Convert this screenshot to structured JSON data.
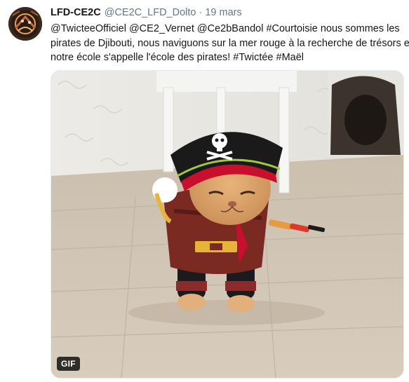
{
  "tweet": {
    "author_name": "LFD-CE2C",
    "author_handle": "@CE2C_LFD_Dolto",
    "separator": "·",
    "date": "19 mars",
    "text_lines": [
      "@TwicteeOfficiel @CE2_Vernet @Ce2bBandol #Courtoisie nous sommes les",
      "pirates de Djibouti, nous naviguons sur la mer rouge à la recherche de trésors et",
      "notre école s'appelle l'école des pirates! #Twictée #Maël"
    ],
    "media": {
      "badge": "GIF",
      "subject": "cat-in-pirate-costume"
    }
  },
  "colors": {
    "text": "#14171a",
    "secondary": "#657786",
    "border": "#e6ecf0",
    "pirate_hat": "#1a1a1a",
    "hat_band": "#c8102e",
    "cat_fur": "#d9a06a"
  }
}
